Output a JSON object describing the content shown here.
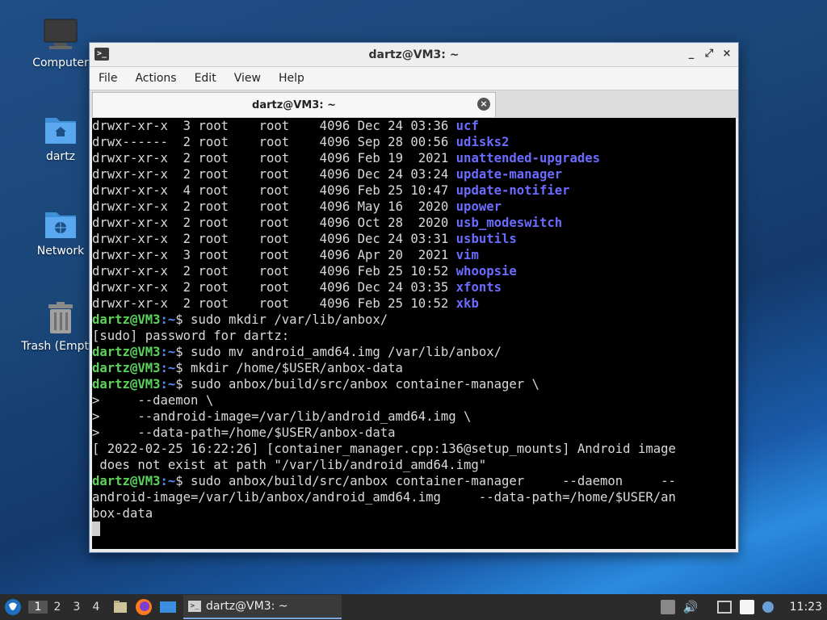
{
  "desktop": {
    "icons": [
      {
        "label": "Computer"
      },
      {
        "label": "dartz"
      },
      {
        "label": "Network"
      },
      {
        "label": "Trash (Empty)"
      }
    ]
  },
  "window": {
    "title": "dartz@VM3: ~",
    "menu": [
      "File",
      "Actions",
      "Edit",
      "View",
      "Help"
    ],
    "tab_label": "dartz@VM3: ~",
    "controls": {
      "minimize": "_",
      "maximize": "⤢",
      "close": "×"
    }
  },
  "terminal": {
    "listing": [
      {
        "perm": "drwxr-xr-x",
        "n": "3",
        "user": "root",
        "group": "root",
        "size": "4096",
        "date": "Dec 24 03:36",
        "name": "ucf"
      },
      {
        "perm": "drwx------",
        "n": "2",
        "user": "root",
        "group": "root",
        "size": "4096",
        "date": "Sep 28 00:56",
        "name": "udisks2"
      },
      {
        "perm": "drwxr-xr-x",
        "n": "2",
        "user": "root",
        "group": "root",
        "size": "4096",
        "date": "Feb 19  2021",
        "name": "unattended-upgrades"
      },
      {
        "perm": "drwxr-xr-x",
        "n": "2",
        "user": "root",
        "group": "root",
        "size": "4096",
        "date": "Dec 24 03:24",
        "name": "update-manager"
      },
      {
        "perm": "drwxr-xr-x",
        "n": "4",
        "user": "root",
        "group": "root",
        "size": "4096",
        "date": "Feb 25 10:47",
        "name": "update-notifier"
      },
      {
        "perm": "drwxr-xr-x",
        "n": "2",
        "user": "root",
        "group": "root",
        "size": "4096",
        "date": "May 16  2020",
        "name": "upower"
      },
      {
        "perm": "drwxr-xr-x",
        "n": "2",
        "user": "root",
        "group": "root",
        "size": "4096",
        "date": "Oct 28  2020",
        "name": "usb_modeswitch"
      },
      {
        "perm": "drwxr-xr-x",
        "n": "2",
        "user": "root",
        "group": "root",
        "size": "4096",
        "date": "Dec 24 03:31",
        "name": "usbutils"
      },
      {
        "perm": "drwxr-xr-x",
        "n": "3",
        "user": "root",
        "group": "root",
        "size": "4096",
        "date": "Apr 20  2021",
        "name": "vim"
      },
      {
        "perm": "drwxr-xr-x",
        "n": "2",
        "user": "root",
        "group": "root",
        "size": "4096",
        "date": "Feb 25 10:52",
        "name": "whoopsie"
      },
      {
        "perm": "drwxr-xr-x",
        "n": "2",
        "user": "root",
        "group": "root",
        "size": "4096",
        "date": "Dec 24 03:35",
        "name": "xfonts"
      },
      {
        "perm": "drwxr-xr-x",
        "n": "2",
        "user": "root",
        "group": "root",
        "size": "4096",
        "date": "Feb 25 10:52",
        "name": "xkb"
      }
    ],
    "prompt_user": "dartz@VM3",
    "prompt_path": ":~",
    "prompt_symbol": "$",
    "lines": [
      {
        "type": "cmd",
        "text": " sudo mkdir /var/lib/anbox/"
      },
      {
        "type": "out",
        "text": "[sudo] password for dartz:"
      },
      {
        "type": "cmd",
        "text": " sudo mv android_amd64.img /var/lib/anbox/"
      },
      {
        "type": "cmd",
        "text": " mkdir /home/$USER/anbox-data"
      },
      {
        "type": "cmd",
        "text": " sudo anbox/build/src/anbox container-manager \\"
      },
      {
        "type": "out",
        "text": ">     --daemon \\"
      },
      {
        "type": "out",
        "text": ">     --android-image=/var/lib/android_amd64.img \\"
      },
      {
        "type": "out",
        "text": ">     --data-path=/home/$USER/anbox-data"
      },
      {
        "type": "out",
        "text": "[ 2022-02-25 16:22:26] [container_manager.cpp:136@setup_mounts] Android image"
      },
      {
        "type": "out",
        "text": " does not exist at path \"/var/lib/android_amd64.img\""
      },
      {
        "type": "cmd",
        "text": " sudo anbox/build/src/anbox container-manager     --daemon     --"
      },
      {
        "type": "out",
        "text": "android-image=/var/lib/anbox/android_amd64.img     --data-path=/home/$USER/an"
      },
      {
        "type": "out",
        "text": "box-data"
      }
    ]
  },
  "taskbar": {
    "workspaces": [
      "1",
      "2",
      "3",
      "4"
    ],
    "active_workspace": "1",
    "task_label": "dartz@VM3: ~",
    "clock": "11:23"
  },
  "colors": {
    "dir": "#6b6bff",
    "prompt_user": "#5bd35b",
    "prompt_path": "#5b8cff"
  }
}
